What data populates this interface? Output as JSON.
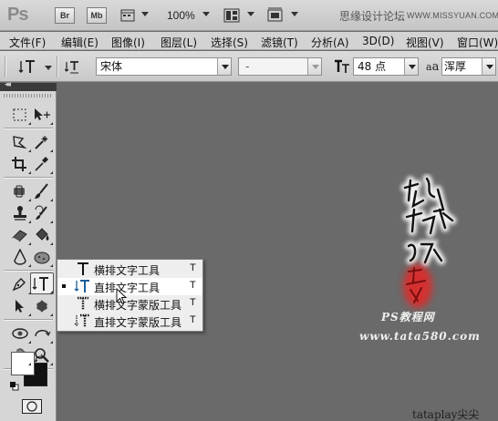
{
  "app": {
    "logo": "Ps",
    "bridge_button": "Br",
    "minibridge_button": "Mb",
    "zoom": "100%"
  },
  "brand": {
    "name": "思缘设计论坛",
    "url": "WWW.MISSYUAN.COM"
  },
  "menus": [
    "文件(F)",
    "编辑(E)",
    "图像(I)",
    "图层(L)",
    "选择(S)",
    "滤镜(T)",
    "分析(A)",
    "3D(D)",
    "视图(V)",
    "窗口(W)"
  ],
  "options": {
    "tool_icon": "vertical-type-icon",
    "orientation_icon": "toggle-orientation-icon",
    "font_family": "宋体",
    "font_style": "-",
    "font_size": "48 点",
    "antialias_label": "a",
    "antialias": "浑厚"
  },
  "toolbox": {
    "collapse_glyph": "◂◂"
  },
  "flyout": {
    "items": [
      {
        "label": "横排文字工具",
        "shortcut": "T",
        "icon": "horizontal-type-icon",
        "selected": false
      },
      {
        "label": "直排文字工具",
        "shortcut": "T",
        "icon": "vertical-type-icon",
        "selected": true
      },
      {
        "label": "横排文字蒙版工具",
        "shortcut": "T",
        "icon": "horizontal-type-mask-icon",
        "selected": false
      },
      {
        "label": "直排文字蒙版工具",
        "shortcut": "T",
        "icon": "vertical-type-mask-icon",
        "selected": false
      }
    ]
  },
  "canvas": {
    "site_tag": "PS教程网",
    "site_url": "www.tata580.com",
    "watermark": "tataplay尖尖"
  }
}
